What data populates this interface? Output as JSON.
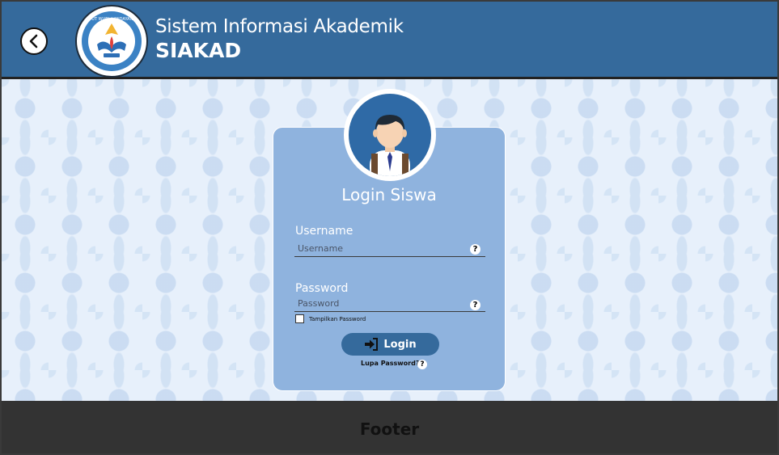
{
  "header": {
    "subtitle": "Sistem Informasi Akademik",
    "title": "SIAKAD",
    "back_icon": "chevron-left-icon",
    "logo": "tut-wuri-handayani-logo",
    "logo_text": "TUT WURI HANDAYANI"
  },
  "login": {
    "title": "Login Siswa",
    "avatar": "student-avatar",
    "username_label": "Username",
    "username_placeholder": "Username",
    "password_label": "Password",
    "password_placeholder": "Password",
    "help_icon_glyph": "?",
    "show_password_label": "Tampilkan Password",
    "show_password_checked": false,
    "login_button": "Login",
    "login_icon": "sign-in-icon",
    "forgot_password": "Lupa Password?"
  },
  "footer": {
    "text": "Footer"
  },
  "colors": {
    "header_bg": "#356a9c",
    "card_bg": "#8fb3de",
    "button_bg": "#356a9c",
    "footer_bg": "#333333",
    "pattern_bg": "#e7f0fb"
  }
}
